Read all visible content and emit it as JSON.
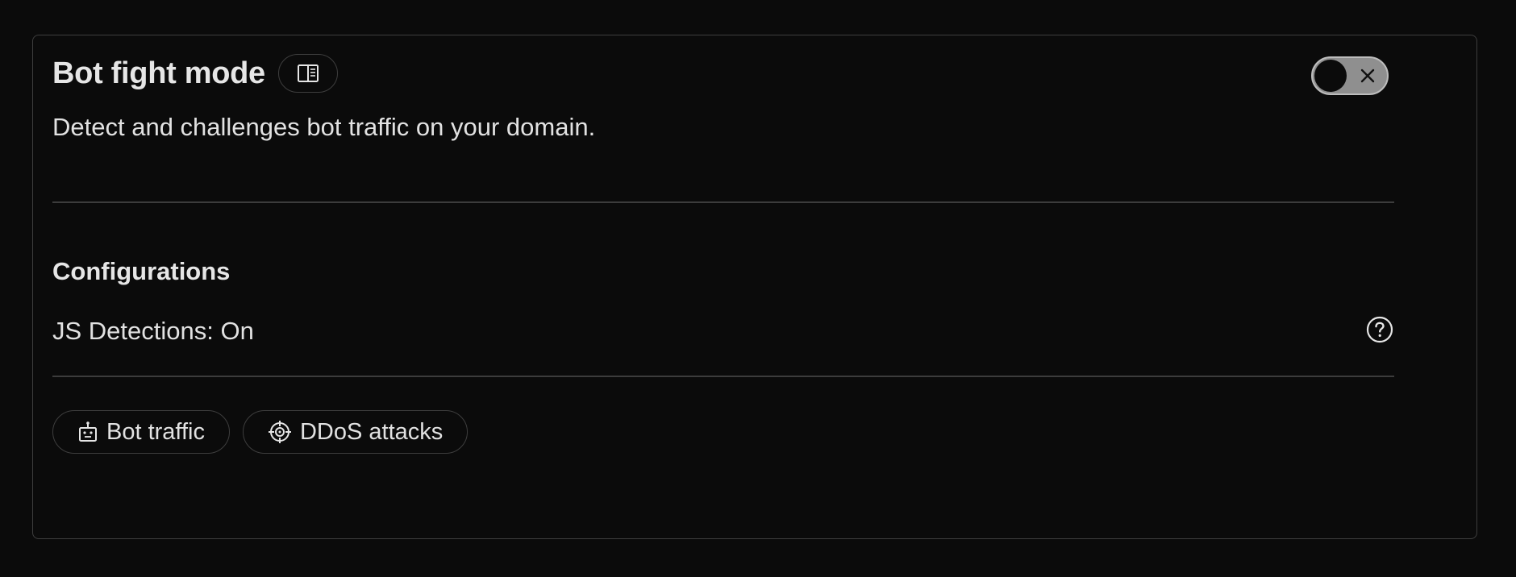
{
  "card": {
    "title": "Bot fight mode",
    "docs_icon": "book-open-icon",
    "description": "Detect and challenges bot traffic on your domain.",
    "toggle": {
      "state": "off",
      "icon": "close-icon"
    }
  },
  "configurations": {
    "heading": "Configurations",
    "settings": [
      {
        "label": "JS Detections: On",
        "icon": "help-circle-icon"
      }
    ]
  },
  "tags": [
    {
      "label": "Bot traffic",
      "icon": "robot-icon"
    },
    {
      "label": "DDoS attacks",
      "icon": "crosshair-icon"
    }
  ],
  "colors": {
    "background": "#0b0b0b",
    "border": "#3e3e3e",
    "text": "#e2e2e2",
    "toggle_track": "#8f8f8f"
  }
}
